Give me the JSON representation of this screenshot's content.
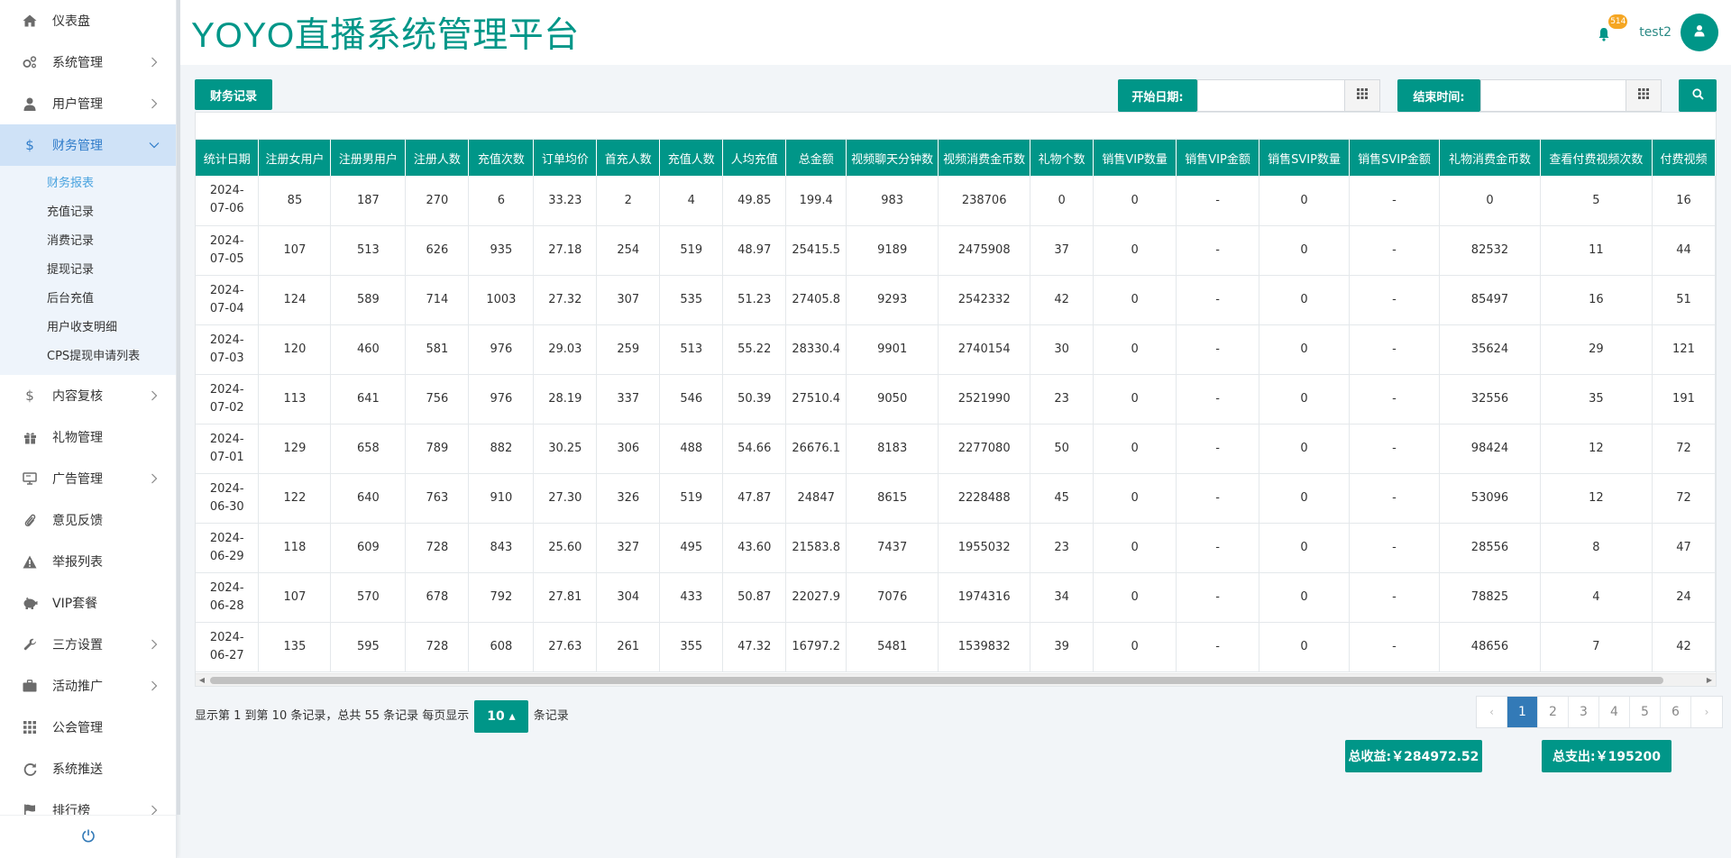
{
  "brand_title": "YOYO直播系统管理平台",
  "header": {
    "notification_count": "514",
    "username": "test2"
  },
  "sidebar": {
    "items": [
      {
        "label": "仪表盘",
        "icon": "home-icon",
        "has_children": false
      },
      {
        "label": "系统管理",
        "icon": "cogs-icon",
        "has_children": true
      },
      {
        "label": "用户管理",
        "icon": "user-icon",
        "has_children": true
      },
      {
        "label": "财务管理",
        "icon": "dollar-icon",
        "has_children": true,
        "expanded": true,
        "children": [
          "财务报表",
          "充值记录",
          "消费记录",
          "提现记录",
          "后台充值",
          "用户收支明细",
          "CPS提现申请列表"
        ]
      },
      {
        "label": "内容复核",
        "icon": "dollar-icon",
        "has_children": true
      },
      {
        "label": "礼物管理",
        "icon": "gift-icon",
        "has_children": false
      },
      {
        "label": "广告管理",
        "icon": "monitor-icon",
        "has_children": true
      },
      {
        "label": "意见反馈",
        "icon": "paperclip-icon",
        "has_children": false
      },
      {
        "label": "举报列表",
        "icon": "warning-icon",
        "has_children": false
      },
      {
        "label": "VIP套餐",
        "icon": "piggy-bank-icon",
        "has_children": false
      },
      {
        "label": "三方设置",
        "icon": "wrench-icon",
        "has_children": true
      },
      {
        "label": "活动推广",
        "icon": "briefcase-icon",
        "has_children": true
      },
      {
        "label": "公会管理",
        "icon": "grid-icon",
        "has_children": false
      },
      {
        "label": "系统推送",
        "icon": "refresh-icon",
        "has_children": false
      },
      {
        "label": "排行榜",
        "icon": "flag-icon",
        "has_children": true
      }
    ],
    "active_sub": "财务报表"
  },
  "toolbar": {
    "records_label": "财务记录",
    "start_date_label": "开始日期:",
    "start_date_value": "",
    "end_date_label": "结束时间:",
    "end_date_value": ""
  },
  "table": {
    "columns": [
      "统计日期",
      "注册女用户",
      "注册男用户",
      "注册人数",
      "充值次数",
      "订单均价",
      "首充人数",
      "充值人数",
      "人均充值",
      "总金额",
      "视频聊天分钟数",
      "视频消费金币数",
      "礼物个数",
      "销售VIP数量",
      "销售VIP金额",
      "销售SVIP数量",
      "销售SVIP金额",
      "礼物消费金币数",
      "查看付费视频次数",
      "付费视频"
    ],
    "rows": [
      [
        "2024-07-06",
        "85",
        "187",
        "270",
        "6",
        "33.23",
        "2",
        "4",
        "49.85",
        "199.4",
        "983",
        "238706",
        "0",
        "0",
        "-",
        "0",
        "-",
        "0",
        "5",
        "16"
      ],
      [
        "2024-07-05",
        "107",
        "513",
        "626",
        "935",
        "27.18",
        "254",
        "519",
        "48.97",
        "25415.5",
        "9189",
        "2475908",
        "37",
        "0",
        "-",
        "0",
        "-",
        "82532",
        "11",
        "44"
      ],
      [
        "2024-07-04",
        "124",
        "589",
        "714",
        "1003",
        "27.32",
        "307",
        "535",
        "51.23",
        "27405.8",
        "9293",
        "2542332",
        "42",
        "0",
        "-",
        "0",
        "-",
        "85497",
        "16",
        "51"
      ],
      [
        "2024-07-03",
        "120",
        "460",
        "581",
        "976",
        "29.03",
        "259",
        "513",
        "55.22",
        "28330.4",
        "9901",
        "2740154",
        "30",
        "0",
        "-",
        "0",
        "-",
        "35624",
        "29",
        "121"
      ],
      [
        "2024-07-02",
        "113",
        "641",
        "756",
        "976",
        "28.19",
        "337",
        "546",
        "50.39",
        "27510.4",
        "9050",
        "2521990",
        "23",
        "0",
        "-",
        "0",
        "-",
        "32556",
        "35",
        "191"
      ],
      [
        "2024-07-01",
        "129",
        "658",
        "789",
        "882",
        "30.25",
        "306",
        "488",
        "54.66",
        "26676.1",
        "8183",
        "2277080",
        "50",
        "0",
        "-",
        "0",
        "-",
        "98424",
        "12",
        "72"
      ],
      [
        "2024-06-30",
        "122",
        "640",
        "763",
        "910",
        "27.30",
        "326",
        "519",
        "47.87",
        "24847",
        "8615",
        "2228488",
        "45",
        "0",
        "-",
        "0",
        "-",
        "53096",
        "12",
        "72"
      ],
      [
        "2024-06-29",
        "118",
        "609",
        "728",
        "843",
        "25.60",
        "327",
        "495",
        "43.60",
        "21583.8",
        "7437",
        "1955032",
        "23",
        "0",
        "-",
        "0",
        "-",
        "28556",
        "8",
        "47"
      ],
      [
        "2024-06-28",
        "107",
        "570",
        "678",
        "792",
        "27.81",
        "304",
        "433",
        "50.87",
        "22027.9",
        "7076",
        "1974316",
        "34",
        "0",
        "-",
        "0",
        "-",
        "78825",
        "4",
        "24"
      ],
      [
        "2024-06-27",
        "135",
        "595",
        "728",
        "608",
        "27.63",
        "261",
        "355",
        "47.32",
        "16797.2",
        "5481",
        "1539832",
        "39",
        "0",
        "-",
        "0",
        "-",
        "48656",
        "7",
        "42"
      ]
    ]
  },
  "footer": {
    "info_prefix": "显示第 1 到第 10 条记录，总共 55 条记录 每页显示",
    "page_size": "10 ▴",
    "info_suffix": "条记录",
    "pages": [
      "‹",
      "1",
      "2",
      "3",
      "4",
      "5",
      "6",
      "›"
    ],
    "current_page": "1",
    "total_income": "总收益:￥284972.52",
    "total_expense": "总支出:￥195200"
  },
  "colors": {
    "accent": "#009688",
    "active_menu_bg": "#cfe2f7",
    "page_active": "#337ab7"
  }
}
